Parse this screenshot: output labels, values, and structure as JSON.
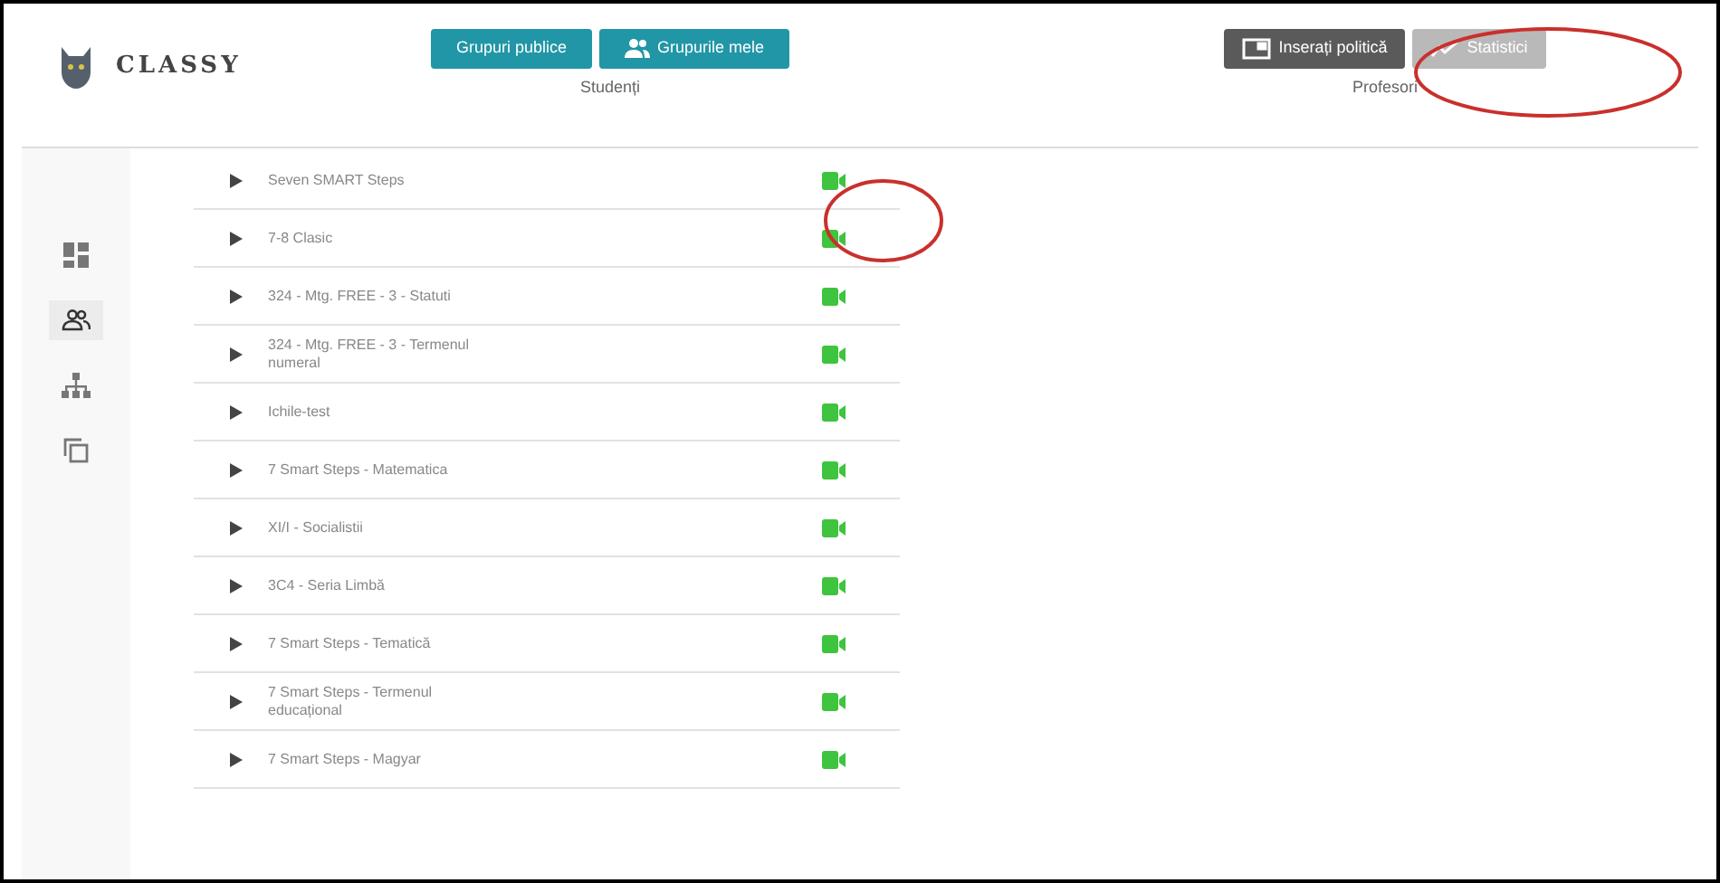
{
  "logo": {
    "text": "CLASSY"
  },
  "students": {
    "heading": "Studenți",
    "buttons": [
      {
        "label": "Grupuri publice",
        "kind": "plain"
      },
      {
        "label": "Grupurile mele",
        "kind": "people"
      }
    ]
  },
  "teachers": {
    "heading": "Profesori",
    "buttons": [
      {
        "label": "Inserați politică",
        "kind": "screen",
        "selected": true
      },
      {
        "label": "Statistici",
        "kind": "chart",
        "selected": false
      }
    ]
  },
  "sidebar": {
    "items": [
      {
        "kind": "dashboard",
        "selected": false
      },
      {
        "kind": "people",
        "selected": true
      },
      {
        "kind": "hierarchy",
        "selected": false
      },
      {
        "kind": "copy",
        "selected": false
      }
    ]
  },
  "groups": [
    {
      "name": "Seven SMART Steps"
    },
    {
      "name": "7-8 Clasic"
    },
    {
      "name": "324 - Mtg. FREE - 3 - Statuti"
    },
    {
      "name": "324 - Mtg. FREE - 3 - Termenul numeral"
    },
    {
      "name": "Ichile-test"
    },
    {
      "name": "7 Smart Steps - Matematica"
    },
    {
      "name": "XI/I - Socialistii"
    },
    {
      "name": "3C4 - Seria Limbă"
    },
    {
      "name": "7 Smart Steps - Tematică"
    },
    {
      "name": "7 Smart Steps - Termenul educațional"
    },
    {
      "name": "7 Smart Steps - Magyar"
    }
  ]
}
